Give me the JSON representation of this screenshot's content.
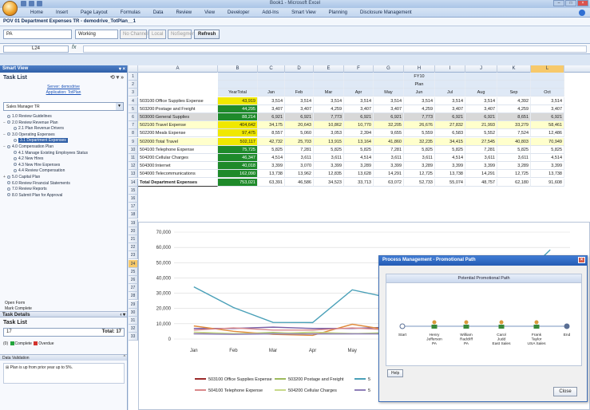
{
  "app": {
    "window_title": "Book1 - Microsoft Excel",
    "ribbon_tabs": [
      "Home",
      "Insert",
      "Page Layout",
      "Formulas",
      "Data",
      "Review",
      "View",
      "Developer",
      "Add-Ins",
      "Smart View",
      "Planning",
      "Disclosure Management"
    ]
  },
  "document": {
    "title": "POV 01 Department Expenses TR - demodrive_TotPlan__1"
  },
  "pov": {
    "entity": "PA",
    "scenario": "Working",
    "channel": "No Channel",
    "local": "Local",
    "segment": "NoSegment",
    "refresh_label": "Refresh"
  },
  "formula_bar": {
    "name_box": "L24",
    "fx": "fx",
    "value": ""
  },
  "sidebar": {
    "header": "Smart View",
    "task_list_title": "Task List",
    "server_line1": "Server: demodrive",
    "server_line2": "Application: TotPlan",
    "task_list_select": "Sales Manager TR",
    "items": [
      {
        "exp": "",
        "label": "1.0 Review Guidelines",
        "indent": 0,
        "sel": false
      },
      {
        "exp": "−",
        "label": "2.0 Review Revenue Plan",
        "indent": 0,
        "sel": false
      },
      {
        "exp": "",
        "label": "2.1 Plan Revenue Drivers",
        "indent": 1,
        "sel": false
      },
      {
        "exp": "−",
        "label": "3.0 Operating Expenses",
        "indent": 0,
        "sel": false
      },
      {
        "exp": "",
        "label": "3.1 Department Expenses",
        "indent": 1,
        "sel": true
      },
      {
        "exp": "−",
        "label": "4.0 Compensation Plan",
        "indent": 0,
        "sel": false
      },
      {
        "exp": "",
        "label": "4.1 Manage Existing Employees Status",
        "indent": 1,
        "sel": false
      },
      {
        "exp": "",
        "label": "4.2 New Hires",
        "indent": 1,
        "sel": false
      },
      {
        "exp": "",
        "label": "4.3 New Hire Expenses",
        "indent": 1,
        "sel": false
      },
      {
        "exp": "",
        "label": "4.4 Review Compensation",
        "indent": 1,
        "sel": false
      },
      {
        "exp": "+",
        "label": "5.0 Capital Plan",
        "indent": 0,
        "sel": false
      },
      {
        "exp": "",
        "label": "6.0 Review Financial Statements",
        "indent": 0,
        "sel": false
      },
      {
        "exp": "",
        "label": "7.0 Review Reports",
        "indent": 0,
        "sel": false
      },
      {
        "exp": "",
        "label": "8.0 Submit Plan for Approval",
        "indent": 0,
        "sel": false
      }
    ],
    "open_form": "Open Form",
    "mark_complete": "Mark Complete",
    "task_details": "Task Details",
    "task_list_2": "Task List",
    "task_count": "17",
    "total_label": "Total: 17",
    "legend_count": "(0)",
    "legend_complete": "Complete",
    "legend_overdue": "Overdue",
    "data_validation": "Data Validation",
    "dv_text": "Plan is up from prior year up to 5%.",
    "colors": {
      "complete": "#22a43a",
      "overdue": "#d2332d"
    }
  },
  "sheet": {
    "columns": [
      "A",
      "B",
      "C",
      "D",
      "E",
      "F",
      "G",
      "H",
      "I",
      "J",
      "K",
      "L"
    ],
    "row_numbers": [
      "1",
      "2",
      "3",
      "4",
      "5",
      "6",
      "7",
      "8",
      "9",
      "10",
      "11",
      "12",
      "13",
      "14",
      "15",
      "16",
      "17",
      "18",
      "19",
      "20",
      "21",
      "22",
      "23",
      "24",
      "25",
      "26",
      "27",
      "28",
      "29",
      "30",
      "31",
      "32",
      "33"
    ],
    "fy_label": "FY10",
    "plan_label": "Plan",
    "header_row": [
      "YearTotal",
      "Jan",
      "Feb",
      "Mar",
      "Apr",
      "May",
      "Jun",
      "Jul",
      "Aug",
      "Sep",
      "Oct"
    ],
    "rows": [
      {
        "label": "503100:Office Supplies Expense",
        "total": "43,919",
        "vals": [
          "3,514",
          "3,514",
          "3,514",
          "3,514",
          "3,514",
          "3,514",
          "3,514",
          "3,514",
          "4,392",
          "3,514"
        ]
      },
      {
        "label": "503200:Postage and Freight",
        "total": "44,295",
        "vals": [
          "3,407",
          "3,407",
          "4,259",
          "3,407",
          "3,407",
          "4,259",
          "3,407",
          "3,407",
          "4,259",
          "3,407"
        ]
      },
      {
        "label": "503000:General Supplies",
        "total": "88,214",
        "vals": [
          "6,921",
          "6,921",
          "7,773",
          "6,921",
          "6,921",
          "7,773",
          "6,921",
          "6,921",
          "8,651",
          "6,921"
        ]
      },
      {
        "label": "502100:Travel Expense",
        "total": "404,642",
        "vals": [
          "34,175",
          "20,643",
          "10,862",
          "10,770",
          "32,205",
          "26,676",
          "27,832",
          "21,993",
          "33,279",
          "58,461"
        ]
      },
      {
        "label": "502200:Meals Expense",
        "total": "97,475",
        "vals": [
          "8,557",
          "5,060",
          "3,053",
          "2,394",
          "9,655",
          "5,559",
          "6,583",
          "5,552",
          "7,524",
          "12,486"
        ]
      },
      {
        "label": "502000:Total Travel",
        "total": "502,117",
        "vals": [
          "42,732",
          "25,703",
          "13,915",
          "13,164",
          "41,860",
          "32,235",
          "34,415",
          "27,545",
          "40,803",
          "70,949"
        ]
      },
      {
        "label": "504100:Telephone Expense",
        "total": "75,725",
        "vals": [
          "5,825",
          "7,281",
          "5,825",
          "5,825",
          "7,281",
          "5,825",
          "5,825",
          "7,281",
          "5,825",
          "5,825"
        ]
      },
      {
        "label": "504200:Cellular Charges",
        "total": "46,347",
        "vals": [
          "4,514",
          "3,611",
          "3,611",
          "4,514",
          "3,611",
          "3,611",
          "4,514",
          "3,611",
          "3,611",
          "4,514"
        ]
      },
      {
        "label": "504300:Internet",
        "total": "40,018",
        "vals": [
          "3,399",
          "3,070",
          "3,399",
          "3,289",
          "3,399",
          "3,289",
          "3,399",
          "3,399",
          "3,289",
          "3,399"
        ]
      },
      {
        "label": "504000:Telecommunications",
        "total": "162,090",
        "vals": [
          "13,738",
          "13,962",
          "12,835",
          "13,628",
          "14,291",
          "12,725",
          "13,738",
          "14,291",
          "12,725",
          "13,738"
        ]
      },
      {
        "label": "Total Department Expenses",
        "total": "753,021",
        "vals": [
          "63,391",
          "46,586",
          "34,523",
          "33,713",
          "63,072",
          "52,733",
          "55,074",
          "48,757",
          "62,180",
          "91,608"
        ]
      }
    ],
    "total_fills": [
      "#f0e800",
      "#1e8a2a",
      "#1e8a2a",
      "#f0e800",
      "#f0e800",
      "#f0e800",
      "#1e8a2a",
      "#1e8a2a",
      "#1e8a2a",
      "#1e8a2a",
      "#1e8a2a"
    ],
    "row_fills": [
      "#ffffff",
      "#ffffff",
      "#d8d8d8",
      "#ffffcc",
      "#ffffff",
      "#ffffcc",
      "#ffffff",
      "#ffffff",
      "#ffffff",
      "#ffffff",
      "#ffffff"
    ]
  },
  "chart_data": {
    "type": "line",
    "categories": [
      "Jan",
      "Feb",
      "Mar",
      "Apr",
      "May",
      "Jun",
      "Jul",
      "Aug",
      "Sep",
      "Oct"
    ],
    "ylim": [
      0,
      70000
    ],
    "yticks": [
      "70,000",
      "60,000",
      "50,000",
      "40,000",
      "30,000",
      "20,000",
      "10,000",
      "0"
    ],
    "series": [
      {
        "name": "503100 Office Supplies Expense",
        "color": "#9b2a2a",
        "values": [
          3514,
          3514,
          3514,
          3514,
          3514,
          3514,
          3514,
          3514,
          4392,
          3514
        ]
      },
      {
        "name": "503200 Postage and Freight",
        "color": "#9dba5d",
        "values": [
          3407,
          3407,
          4259,
          3407,
          3407,
          4259,
          3407,
          3407,
          4259,
          3407
        ]
      },
      {
        "name": "503000 General Supplies",
        "color": "#7a5ea5",
        "values": [
          6921,
          6921,
          7773,
          6921,
          6921,
          7773,
          6921,
          6921,
          8651,
          6921
        ]
      },
      {
        "name": "502100 Travel Expense",
        "color": "#4aa0b8",
        "values": [
          34175,
          20643,
          10862,
          10770,
          32205,
          26676,
          27832,
          21993,
          33279,
          58461
        ]
      },
      {
        "name": "502200 Meals Expense",
        "color": "#e08a3a",
        "values": [
          8557,
          5060,
          3053,
          2394,
          9655,
          5559,
          6583,
          5552,
          7524,
          12486
        ]
      },
      {
        "name": "504100 Telephone Expense",
        "color": "#d9888a",
        "values": [
          5825,
          7281,
          5825,
          5825,
          7281,
          5825,
          5825,
          7281,
          5825,
          5825
        ]
      },
      {
        "name": "504200 Cellular Charges",
        "color": "#c7d98a",
        "values": [
          4514,
          3611,
          3611,
          4514,
          3611,
          3611,
          4514,
          3611,
          3611,
          4514
        ]
      },
      {
        "name": "504300 Internet",
        "color": "#8f7fb8",
        "values": [
          3399,
          3070,
          3399,
          3289,
          3399,
          3289,
          3399,
          3399,
          3289,
          3399
        ]
      }
    ],
    "legend": [
      {
        "label": "503100 Office Supplies Expense",
        "color": "#9b2a2a"
      },
      {
        "label": "503200 Postage and Freight",
        "color": "#9dba5d"
      },
      {
        "label": "5",
        "color": "#4aa0b8"
      },
      {
        "label": "504100 Telephone Expense",
        "color": "#d9888a"
      },
      {
        "label": "504200 Cellular Charges",
        "color": "#c7d98a"
      },
      {
        "label": "5",
        "color": "#8f7fb8"
      }
    ]
  },
  "popup": {
    "title": "Process Management - Promotional Path",
    "inner_title": "Potential Promotional Path",
    "nodes": [
      {
        "label": "Start",
        "kind": "dot"
      },
      {
        "label": "Henry Jefferson PA",
        "kind": "user"
      },
      {
        "label": "William Radcliff PA",
        "kind": "user"
      },
      {
        "label": "Carol Judd East Sales",
        "kind": "user"
      },
      {
        "label": "Frank Taylor USA Sales",
        "kind": "user"
      },
      {
        "label": "End",
        "kind": "dot"
      }
    ],
    "help_label": "Help",
    "close_label": "Close"
  }
}
